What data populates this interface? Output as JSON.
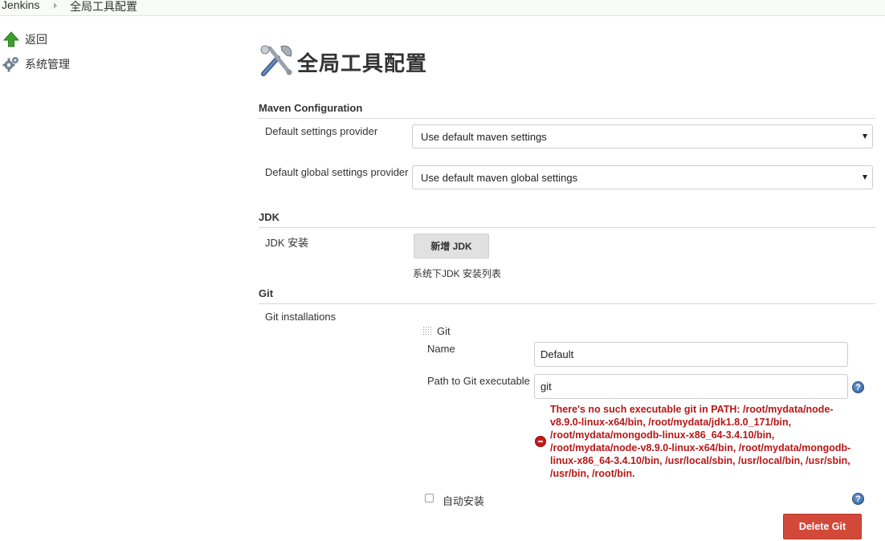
{
  "breadcrumb": {
    "root": "Jenkins",
    "current": "全局工具配置"
  },
  "sidebar": {
    "items": [
      {
        "label": "返回",
        "icon": "up-arrow-icon"
      },
      {
        "label": "系统管理",
        "icon": "gear-icon"
      }
    ]
  },
  "page": {
    "title": "全局工具配置",
    "icon": "tools-icon"
  },
  "maven": {
    "heading": "Maven Configuration",
    "default_settings_label": "Default settings provider",
    "default_settings_value": "Use default maven settings",
    "global_settings_label": "Default global settings provider",
    "global_settings_value": "Use default maven global settings"
  },
  "jdk": {
    "heading": "JDK",
    "install_label": "JDK 安装",
    "add_button": "新增 JDK",
    "hint": "系统下JDK 安装列表"
  },
  "git": {
    "heading": "Git",
    "installations_label": "Git installations",
    "block_title": "Git",
    "name_label": "Name",
    "name_value": "Default",
    "path_label": "Path to Git executable",
    "path_value": "git",
    "help_glyph": "?",
    "error_message": "There's no such executable git in PATH: /root/mydata/node-v8.9.0-linux-x64/bin, /root/mydata/jdk1.8.0_171/bin, /root/mydata/mongodb-linux-x86_64-3.4.10/bin, /root/mydata/node-v8.9.0-linux-x64/bin, /root/mydata/mongodb-linux-x86_64-3.4.10/bin, /usr/local/sbin, /usr/local/bin, /usr/sbin, /usr/bin, /root/bin.",
    "auto_install_label": "自动安装",
    "auto_install_checked": false,
    "delete_button": "Delete Git"
  },
  "colors": {
    "error": "#b81717",
    "delete_button": "#d24939",
    "help_icon": "#2f5f9b"
  }
}
